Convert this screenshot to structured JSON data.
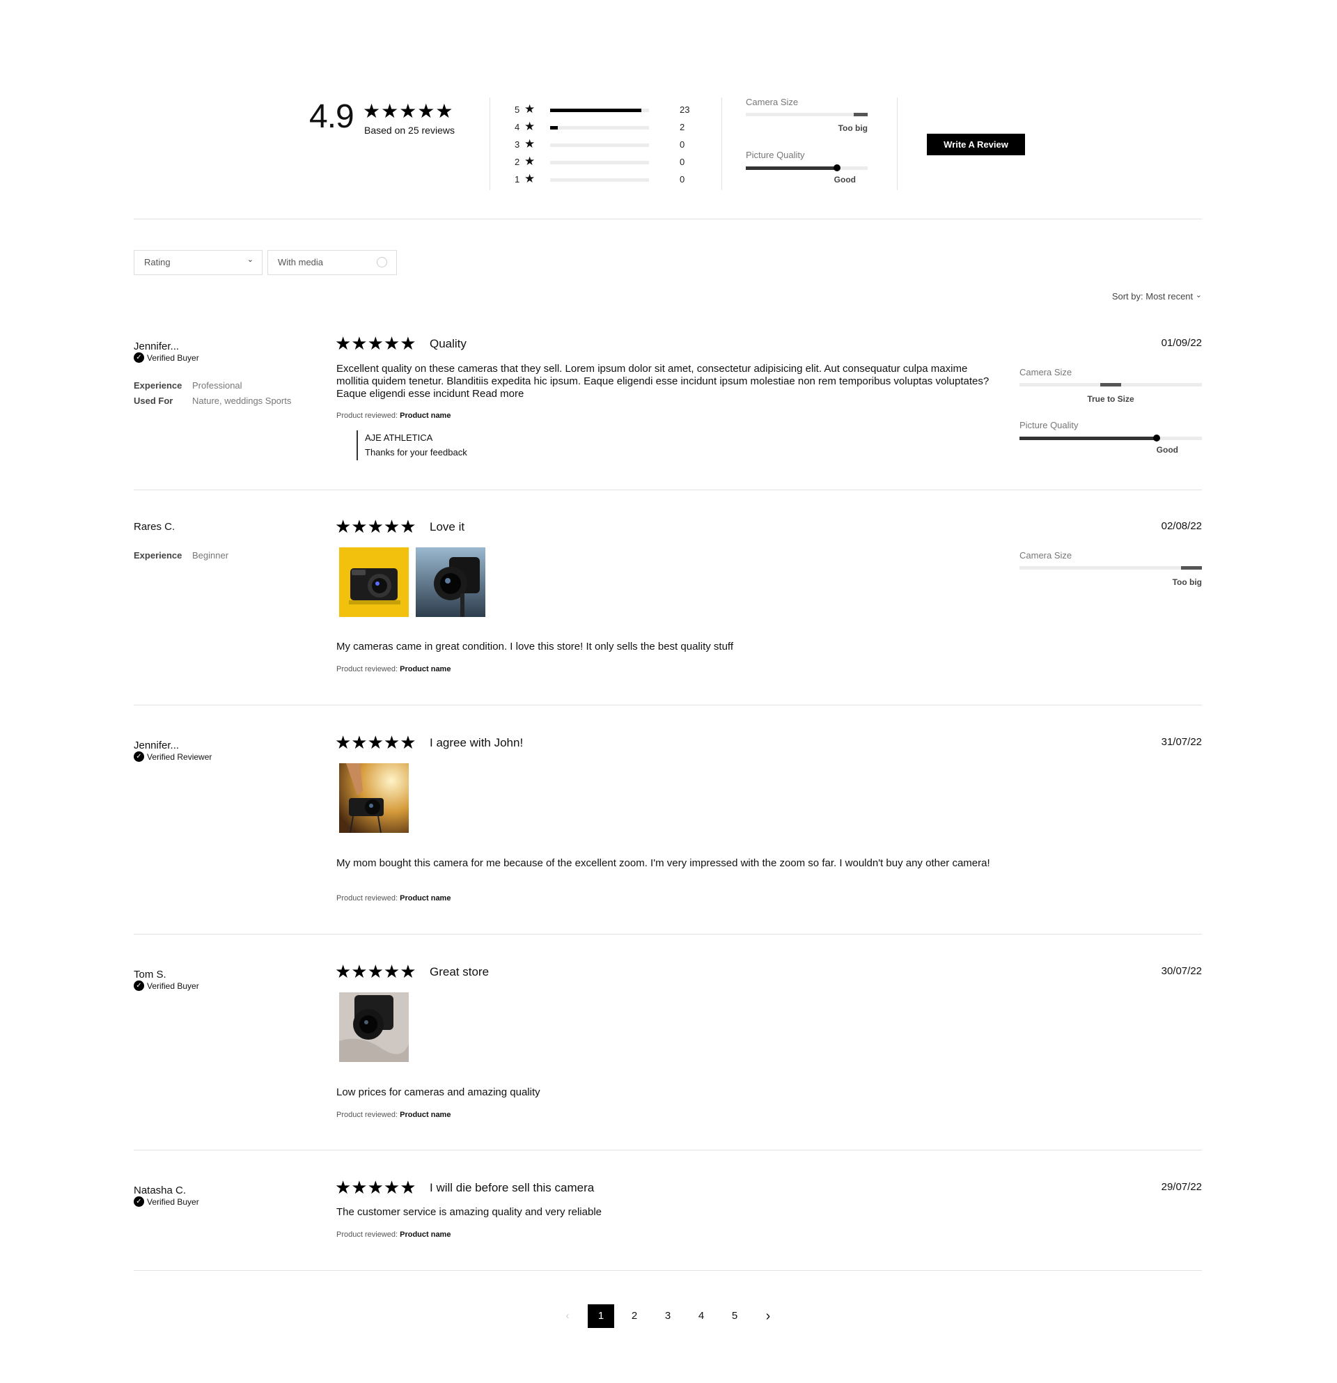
{
  "summary": {
    "score": "4.9",
    "stars": "★★★★★",
    "based_on": "Based on 25 reviews",
    "distribution": [
      {
        "stars": "5",
        "count": "23",
        "fraction": 0.92
      },
      {
        "stars": "4",
        "count": "2",
        "fraction": 0.08
      },
      {
        "stars": "3",
        "count": "0",
        "fraction": 0
      },
      {
        "stars": "2",
        "count": "0",
        "fraction": 0
      },
      {
        "stars": "1",
        "count": "0",
        "fraction": 0
      }
    ],
    "attributes": [
      {
        "label": "Camera Size",
        "value": "Too big",
        "level": 0.95
      },
      {
        "label": "Picture Quality",
        "value": "Good",
        "level": 0.75
      }
    ],
    "write_review_label": "Write A Review"
  },
  "filters": {
    "rating_label": "Rating",
    "with_media_label": "With media",
    "sort_label": "Sort by:",
    "sort_value": "Most recent"
  },
  "reviews": [
    {
      "author": "Jennifer...",
      "badge": "Verified Buyer",
      "meta": [
        {
          "k": "Experience",
          "v": "Professional"
        },
        {
          "k": "Used For",
          "v": "Nature, weddings Sports"
        }
      ],
      "stars": "★★★★★",
      "title": "Quality",
      "date": "01/09/22",
      "body": "Excellent quality on these cameras that they sell. Lorem ipsum dolor sit amet, consectetur adipisicing elit. Aut consequatur culpa maxime mollitia quidem tenetur. Blanditiis expedita hic ipsum. Eaque eligendi esse incidunt ipsum molestiae non rem temporibus voluptas voluptates?  Eaque eligendi esse incidunt Read more",
      "product_prefix": "Product reviewed:",
      "product_name": "Product name",
      "reply_from": "AJE ATHLETICA",
      "reply_text": "Thanks for your feedback",
      "attributes": [
        {
          "label": "Camera Size",
          "value": "True to Size",
          "level": 0.5
        },
        {
          "label": "Picture Quality",
          "value": "Good",
          "level": 0.75
        }
      ]
    },
    {
      "author": "Rares C.",
      "meta": [
        {
          "k": "Experience",
          "v": "Beginner"
        }
      ],
      "stars": "★★★★★",
      "title": "Love it",
      "date": "02/08/22",
      "body": "My cameras came in great condition. I love this store! It only sells the best quality stuff",
      "product_prefix": "Product reviewed:",
      "product_name": "Product name",
      "attributes": [
        {
          "label": "Camera Size",
          "value": "Too big",
          "level": 0.95
        }
      ]
    },
    {
      "author": "Jennifer...",
      "badge": "Verified Reviewer",
      "stars": "★★★★★",
      "title": "I agree with John!",
      "date": "31/07/22",
      "body": "My mom bought this camera for me because of the excellent zoom. I'm very impressed with the zoom so far. I wouldn't buy any other camera!",
      "product_prefix": "Product reviewed:",
      "product_name": "Product name"
    },
    {
      "author": "Tom S.",
      "badge": "Verified Buyer",
      "stars": "★★★★★",
      "title": "Great store",
      "date": "30/07/22",
      "body": "Low prices for cameras and amazing quality",
      "product_prefix": "Product reviewed:",
      "product_name": "Product name"
    },
    {
      "author": "Natasha C.",
      "badge": "Verified Buyer",
      "stars": "★★★★★",
      "title": "I will die before sell this camera",
      "date": "29/07/22",
      "body": "The customer service is amazing quality and very reliable",
      "product_prefix": "Product reviewed:",
      "product_name": "Product name"
    }
  ],
  "pagination": {
    "prev": "‹",
    "pages": [
      "1",
      "2",
      "3",
      "4",
      "5"
    ],
    "current": "1",
    "next": "›"
  },
  "icons": {
    "star": "★",
    "check": "✓",
    "chevron": "⌄"
  }
}
